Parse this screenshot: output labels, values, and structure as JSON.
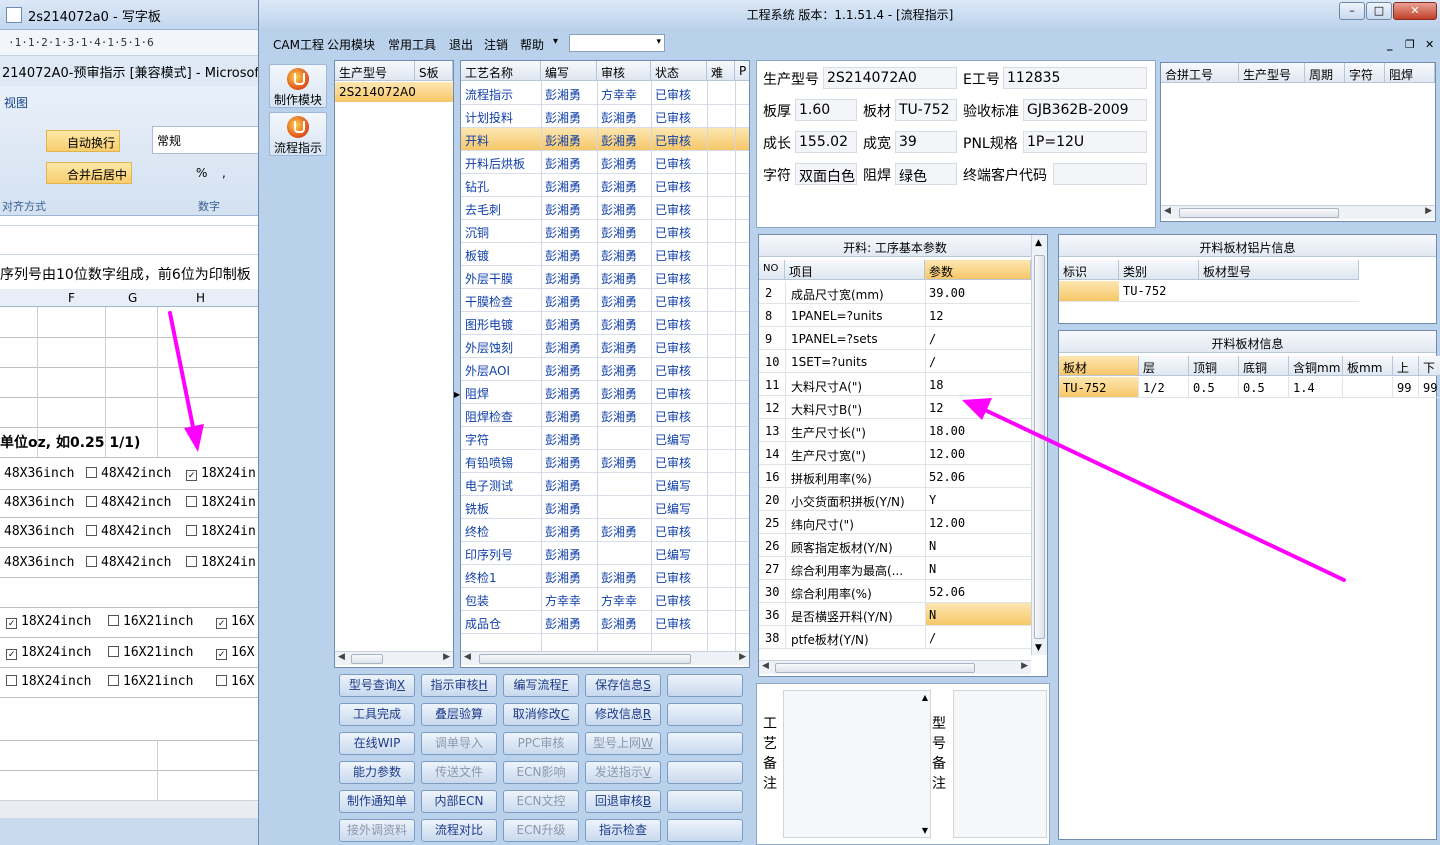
{
  "background": {
    "word_title": "2s214072a0 - 写字板",
    "ruler": "·1·1·2·1·3·1·4·1·5·1·6",
    "excel_title": "214072A0-预审指示  [兼容模式] - Microsoft E",
    "ribbon_tab": "视图",
    "btn_wrap": "自动换行",
    "btn_merge": "合并后居中",
    "format_box": "常规",
    "percent": "%",
    "comma": ",",
    "group_align": "对齐方式",
    "group_number": "数字",
    "cell_note": "序列号由10位数字组成，前6位为印制板",
    "col_headers": [
      "F",
      "G",
      "H"
    ],
    "unit_note": "单位oz, 如0.25 1/1)",
    "size_rows": [
      [
        "48X36inch",
        "48X42inch",
        "18X24in"
      ],
      [
        "48X36inch",
        "48X42inch",
        "18X24in"
      ],
      [
        "48X36inch",
        "48X42inch",
        "18X24in"
      ],
      [
        "48X36inch",
        "48X42inch",
        "18X24in"
      ]
    ],
    "size_rows2": [
      [
        "18X24inch",
        "16X21inch",
        "16X"
      ],
      [
        "18X24inch",
        "16X21inch",
        "16X"
      ],
      [
        "18X24inch",
        "16X21inch",
        "16X"
      ]
    ],
    "check_mark": "✓"
  },
  "main": {
    "title": "工程系统   版本：1.1.51.4 - [流程指示]",
    "menu": [
      "CAM工程",
      "公用模块",
      "常用工具",
      "退出",
      "注销",
      "帮助"
    ],
    "menu_more": "▾",
    "nav": [
      "制作模块",
      "流程指示"
    ],
    "model_grid": {
      "headers": [
        "生产型号",
        "S板"
      ],
      "rows": [
        "2S214072A0"
      ]
    },
    "proc_grid": {
      "headers": [
        "工艺名称",
        "编写",
        "审核",
        "状态",
        "难",
        "P"
      ],
      "selected_index": 2,
      "rows": [
        [
          "流程指示",
          "彭湘勇",
          "方幸幸",
          "已审核"
        ],
        [
          "计划投料",
          "彭湘勇",
          "彭湘勇",
          "已审核"
        ],
        [
          "开料",
          "彭湘勇",
          "彭湘勇",
          "已审核"
        ],
        [
          "开料后烘板",
          "彭湘勇",
          "彭湘勇",
          "已审核"
        ],
        [
          "钻孔",
          "彭湘勇",
          "彭湘勇",
          "已审核"
        ],
        [
          "去毛刺",
          "彭湘勇",
          "彭湘勇",
          "已审核"
        ],
        [
          "沉铜",
          "彭湘勇",
          "彭湘勇",
          "已审核"
        ],
        [
          "板镀",
          "彭湘勇",
          "彭湘勇",
          "已审核"
        ],
        [
          "外层干膜",
          "彭湘勇",
          "彭湘勇",
          "已审核"
        ],
        [
          "干膜检查",
          "彭湘勇",
          "彭湘勇",
          "已审核"
        ],
        [
          "图形电镀",
          "彭湘勇",
          "彭湘勇",
          "已审核"
        ],
        [
          "外层蚀刻",
          "彭湘勇",
          "彭湘勇",
          "已审核"
        ],
        [
          "外层AOI",
          "彭湘勇",
          "彭湘勇",
          "已审核"
        ],
        [
          "阻焊",
          "彭湘勇",
          "彭湘勇",
          "已审核"
        ],
        [
          "阻焊检查",
          "彭湘勇",
          "彭湘勇",
          "已审核"
        ],
        [
          "字符",
          "彭湘勇",
          "",
          "已编写"
        ],
        [
          "有铅喷锡",
          "彭湘勇",
          "彭湘勇",
          "已审核"
        ],
        [
          "电子测试",
          "彭湘勇",
          "",
          "已编写"
        ],
        [
          "铣板",
          "彭湘勇",
          "",
          "已编写"
        ],
        [
          "终检",
          "彭湘勇",
          "彭湘勇",
          "已审核"
        ],
        [
          "印序列号",
          "彭湘勇",
          "",
          "已编写"
        ],
        [
          "终检1",
          "彭湘勇",
          "彭湘勇",
          "已审核"
        ],
        [
          "包装",
          "方幸幸",
          "方幸幸",
          "已审核"
        ],
        [
          "成品仓",
          "彭湘勇",
          "彭湘勇",
          "已审核"
        ]
      ]
    },
    "buttons": [
      [
        {
          "label": "型号查询",
          "key": "X"
        },
        {
          "label": "指示审核",
          "key": "H"
        },
        {
          "label": "编写流程",
          "key": "F"
        },
        {
          "label": "保存信息",
          "key": "S"
        },
        {
          "label": "",
          "key": ""
        }
      ],
      [
        {
          "label": "工具完成",
          "key": ""
        },
        {
          "label": "叠层验算",
          "key": ""
        },
        {
          "label": "取消修改",
          "key": "C"
        },
        {
          "label": "修改信息",
          "key": "R"
        },
        {
          "label": "",
          "key": ""
        }
      ],
      [
        {
          "label": "在线WIP",
          "key": ""
        },
        {
          "label": "调单导入",
          "key": "",
          "dis": true
        },
        {
          "label": "PPC审核",
          "key": "",
          "dis": true
        },
        {
          "label": "型号上网",
          "key": "W",
          "dis": true
        },
        {
          "label": "",
          "key": ""
        }
      ],
      [
        {
          "label": "能力参数",
          "key": ""
        },
        {
          "label": "传送文件",
          "key": "",
          "dis": true
        },
        {
          "label": "ECN影响",
          "key": "",
          "dis": true
        },
        {
          "label": "发送指示",
          "key": "V",
          "dis": true
        },
        {
          "label": "",
          "key": ""
        }
      ],
      [
        {
          "label": "制作通知单",
          "key": ""
        },
        {
          "label": "内部ECN",
          "key": ""
        },
        {
          "label": "ECN文控",
          "key": "",
          "dis": true
        },
        {
          "label": "回退审核",
          "key": "B"
        },
        {
          "label": "",
          "key": ""
        }
      ],
      [
        {
          "label": "接外调资料",
          "key": "",
          "dis": true
        },
        {
          "label": "流程对比",
          "key": ""
        },
        {
          "label": "ECN升级",
          "key": "",
          "dis": true
        },
        {
          "label": "指示检查",
          "key": ""
        },
        {
          "label": "",
          "key": ""
        }
      ]
    ],
    "info": {
      "model_label": "生产型号",
      "model_value": "2S214072A0",
      "e_label": "E工号",
      "e_value": "112835",
      "thick_label": "板厚",
      "thick_value": "1.60",
      "mat_label": "板材",
      "mat_value": "TU-752",
      "std_label": "验收标准",
      "std_value": "GJB362B-2009",
      "len_label": "成长",
      "len_value": "155.02",
      "wid_label": "成宽",
      "wid_value": "39",
      "pnl_label": "PNL规格",
      "pnl_value": "1P=12U",
      "char_label": "字符",
      "char_value": "双面白色",
      "mask_label": "阻焊",
      "mask_value": "绿色",
      "cust_label": "终端客户代码",
      "cust_value": ""
    },
    "merge_grid": {
      "headers": [
        "合拼工号",
        "生产型号",
        "周期",
        "字符",
        "阻焊"
      ]
    },
    "params": {
      "title": "开料: 工序基本参数",
      "headers": [
        "NO",
        "项目",
        "参数"
      ],
      "selected_index": 14,
      "rows": [
        [
          "2",
          "成品尺寸宽(mm)",
          "39.00"
        ],
        [
          "8",
          "1PANEL=?units",
          "12"
        ],
        [
          "9",
          "1PANEL=?sets",
          "/"
        ],
        [
          "10",
          "1SET=?units",
          "/"
        ],
        [
          "11",
          "大料尺寸A(\")",
          "18"
        ],
        [
          "12",
          "大料尺寸B(\")",
          "12"
        ],
        [
          "13",
          "生产尺寸长(\")",
          "18.00"
        ],
        [
          "14",
          "生产尺寸宽(\")",
          "12.00"
        ],
        [
          "16",
          "拼板利用率(%)",
          "52.06"
        ],
        [
          "20",
          "小交货面积拼板(Y/N)",
          "Y"
        ],
        [
          "25",
          "纬向尺寸(\")",
          "12.00"
        ],
        [
          "26",
          "顾客指定板材(Y/N)",
          "N"
        ],
        [
          "27",
          "综合利用率为最高(...",
          "N"
        ],
        [
          "30",
          "综合利用率(%)",
          "52.06"
        ],
        [
          "36",
          "是否横竖开料(Y/N)",
          "N"
        ],
        [
          "38",
          "ptfe板材(Y/N)",
          "/"
        ]
      ]
    },
    "alu": {
      "title": "开料板材铝片信息",
      "headers": [
        "标识",
        "类别",
        "板材型号"
      ],
      "rows": [
        [
          "",
          "TU-752",
          ""
        ]
      ]
    },
    "material": {
      "title": "开料板材信息",
      "headers": [
        "板材",
        "层",
        "顶铜",
        "底铜",
        "含铜mm",
        "板mm",
        "上",
        "下"
      ],
      "rows": [
        [
          "TU-752",
          "1/2",
          "0.5",
          "0.5",
          "1.4",
          "",
          "99",
          "99"
        ]
      ]
    },
    "notes": {
      "proc_label": "工艺备注",
      "model_label": "型号备注"
    }
  },
  "colors": {
    "accent": "#ff00ff",
    "selection": "#f7c768",
    "link": "#0f3fa8"
  }
}
